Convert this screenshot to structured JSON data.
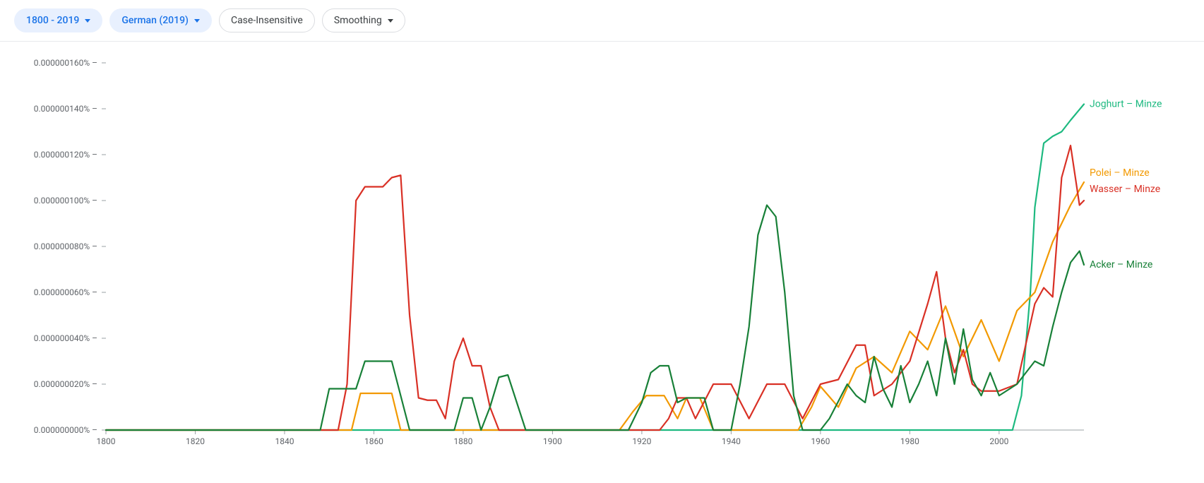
{
  "toolbar": {
    "range_label": "1800 - 2019",
    "corpus_label": "German (2019)",
    "case_label": "Case-Insensitive",
    "smoothing_label": "Smoothing"
  },
  "chart_data": {
    "type": "line",
    "x_start": 1800,
    "x_end": 2019,
    "x_ticks": [
      1800,
      1820,
      1840,
      1860,
      1880,
      1900,
      1920,
      1940,
      1960,
      1980,
      2000
    ],
    "ylim": [
      0,
      1.6e-07
    ],
    "y_ticks": [
      {
        "v": 0.0,
        "label": "0.000000000%"
      },
      {
        "v": 2e-08,
        "label": "0.000000020%"
      },
      {
        "v": 4e-08,
        "label": "0.000000040%"
      },
      {
        "v": 6e-08,
        "label": "0.000000060%"
      },
      {
        "v": 8e-08,
        "label": "0.000000080%"
      },
      {
        "v": 1e-07,
        "label": "0.000000100%"
      },
      {
        "v": 1.2e-07,
        "label": "0.000000120%"
      },
      {
        "v": 1.4e-07,
        "label": "0.000000140%"
      },
      {
        "v": 1.6e-07,
        "label": "0.000000160%"
      }
    ],
    "series": [
      {
        "name": "Joghurt – Minze",
        "color": "#1db980",
        "label_y": 1.42e-07,
        "points": [
          [
            1800,
            0
          ],
          [
            2000,
            0
          ],
          [
            2003,
            0
          ],
          [
            2005,
            1.5e-08
          ],
          [
            2007,
            6e-08
          ],
          [
            2008,
            9.7e-08
          ],
          [
            2010,
            1.25e-07
          ],
          [
            2012,
            1.28e-07
          ],
          [
            2014,
            1.3e-07
          ],
          [
            2016,
            1.35e-07
          ],
          [
            2019,
            1.42e-07
          ]
        ]
      },
      {
        "name": "Polei – Minze",
        "color": "#f29900",
        "label_y": 1.12e-07,
        "points": [
          [
            1800,
            0
          ],
          [
            1855,
            0
          ],
          [
            1857,
            1.6e-08
          ],
          [
            1862,
            1.6e-08
          ],
          [
            1864,
            1.6e-08
          ],
          [
            1866,
            0
          ],
          [
            1915,
            0
          ],
          [
            1918,
            8e-09
          ],
          [
            1921,
            1.5e-08
          ],
          [
            1925,
            1.5e-08
          ],
          [
            1928,
            5e-09
          ],
          [
            1930,
            1.4e-08
          ],
          [
            1933,
            1.4e-08
          ],
          [
            1936,
            0
          ],
          [
            1955,
            0
          ],
          [
            1958,
            1e-08
          ],
          [
            1960,
            1.9e-08
          ],
          [
            1964,
            1e-08
          ],
          [
            1968,
            2.7e-08
          ],
          [
            1972,
            3.2e-08
          ],
          [
            1976,
            2.5e-08
          ],
          [
            1980,
            4.3e-08
          ],
          [
            1984,
            3.5e-08
          ],
          [
            1988,
            5.4e-08
          ],
          [
            1992,
            3.2e-08
          ],
          [
            1996,
            4.8e-08
          ],
          [
            2000,
            3e-08
          ],
          [
            2004,
            5.2e-08
          ],
          [
            2008,
            6e-08
          ],
          [
            2012,
            8.2e-08
          ],
          [
            2016,
            9.8e-08
          ],
          [
            2019,
            1.08e-07
          ]
        ]
      },
      {
        "name": "Wasser – Minze",
        "color": "#d93025",
        "label_y": 1.05e-07,
        "points": [
          [
            1800,
            0
          ],
          [
            1852,
            0
          ],
          [
            1854,
            2e-08
          ],
          [
            1856,
            1e-07
          ],
          [
            1858,
            1.06e-07
          ],
          [
            1860,
            1.06e-07
          ],
          [
            1862,
            1.06e-07
          ],
          [
            1864,
            1.1e-07
          ],
          [
            1866,
            1.11e-07
          ],
          [
            1868,
            5e-08
          ],
          [
            1870,
            1.4e-08
          ],
          [
            1872,
            1.3e-08
          ],
          [
            1874,
            1.3e-08
          ],
          [
            1876,
            5e-09
          ],
          [
            1878,
            3e-08
          ],
          [
            1880,
            4e-08
          ],
          [
            1882,
            2.8e-08
          ],
          [
            1884,
            2.8e-08
          ],
          [
            1886,
            1e-08
          ],
          [
            1888,
            0
          ],
          [
            1924,
            0
          ],
          [
            1926,
            5e-09
          ],
          [
            1928,
            1.4e-08
          ],
          [
            1930,
            1.4e-08
          ],
          [
            1932,
            5e-09
          ],
          [
            1936,
            2e-08
          ],
          [
            1940,
            2e-08
          ],
          [
            1944,
            5e-09
          ],
          [
            1948,
            2e-08
          ],
          [
            1952,
            2e-08
          ],
          [
            1956,
            5e-09
          ],
          [
            1960,
            2e-08
          ],
          [
            1964,
            2.2e-08
          ],
          [
            1968,
            3.7e-08
          ],
          [
            1970,
            3.7e-08
          ],
          [
            1972,
            1.5e-08
          ],
          [
            1976,
            2e-08
          ],
          [
            1980,
            3e-08
          ],
          [
            1984,
            5.5e-08
          ],
          [
            1986,
            6.9e-08
          ],
          [
            1988,
            4e-08
          ],
          [
            1990,
            2.5e-08
          ],
          [
            1992,
            3.5e-08
          ],
          [
            1994,
            2e-08
          ],
          [
            1996,
            1.7e-08
          ],
          [
            1998,
            1.7e-08
          ],
          [
            2000,
            1.7e-08
          ],
          [
            2004,
            2e-08
          ],
          [
            2008,
            5.5e-08
          ],
          [
            2010,
            6.2e-08
          ],
          [
            2012,
            5.8e-08
          ],
          [
            2014,
            1.1e-07
          ],
          [
            2016,
            1.24e-07
          ],
          [
            2018,
            9.8e-08
          ],
          [
            2019,
            1e-07
          ]
        ]
      },
      {
        "name": "Acker – Minze",
        "color": "#188038",
        "label_y": 7.2e-08,
        "points": [
          [
            1800,
            0
          ],
          [
            1848,
            0
          ],
          [
            1850,
            1.8e-08
          ],
          [
            1852,
            1.8e-08
          ],
          [
            1854,
            1.8e-08
          ],
          [
            1856,
            1.8e-08
          ],
          [
            1858,
            3e-08
          ],
          [
            1860,
            3e-08
          ],
          [
            1862,
            3e-08
          ],
          [
            1864,
            3e-08
          ],
          [
            1866,
            1.5e-08
          ],
          [
            1868,
            0
          ],
          [
            1878,
            0
          ],
          [
            1880,
            1.4e-08
          ],
          [
            1882,
            1.4e-08
          ],
          [
            1884,
            0
          ],
          [
            1886,
            1e-08
          ],
          [
            1888,
            2.3e-08
          ],
          [
            1890,
            2.4e-08
          ],
          [
            1892,
            1.2e-08
          ],
          [
            1894,
            0
          ],
          [
            1917,
            0
          ],
          [
            1920,
            1.2e-08
          ],
          [
            1922,
            2.5e-08
          ],
          [
            1924,
            2.8e-08
          ],
          [
            1926,
            2.8e-08
          ],
          [
            1928,
            1.2e-08
          ],
          [
            1930,
            1.4e-08
          ],
          [
            1932,
            1.4e-08
          ],
          [
            1934,
            1.4e-08
          ],
          [
            1936,
            0
          ],
          [
            1940,
            0
          ],
          [
            1942,
            2e-08
          ],
          [
            1944,
            4.5e-08
          ],
          [
            1946,
            8.5e-08
          ],
          [
            1948,
            9.8e-08
          ],
          [
            1950,
            9.3e-08
          ],
          [
            1952,
            6e-08
          ],
          [
            1954,
            1.5e-08
          ],
          [
            1956,
            0
          ],
          [
            1960,
            0
          ],
          [
            1962,
            5e-09
          ],
          [
            1966,
            2e-08
          ],
          [
            1968,
            1.5e-08
          ],
          [
            1970,
            1.2e-08
          ],
          [
            1972,
            3.2e-08
          ],
          [
            1974,
            1.8e-08
          ],
          [
            1976,
            1e-08
          ],
          [
            1978,
            2.8e-08
          ],
          [
            1980,
            1.2e-08
          ],
          [
            1982,
            2e-08
          ],
          [
            1984,
            3e-08
          ],
          [
            1986,
            1.5e-08
          ],
          [
            1988,
            4e-08
          ],
          [
            1990,
            2e-08
          ],
          [
            1992,
            4.4e-08
          ],
          [
            1994,
            2.2e-08
          ],
          [
            1996,
            1.5e-08
          ],
          [
            1998,
            2.5e-08
          ],
          [
            2000,
            1.5e-08
          ],
          [
            2004,
            2e-08
          ],
          [
            2008,
            3e-08
          ],
          [
            2010,
            2.8e-08
          ],
          [
            2012,
            4.5e-08
          ],
          [
            2014,
            6e-08
          ],
          [
            2016,
            7.3e-08
          ],
          [
            2018,
            7.8e-08
          ],
          [
            2019,
            7.2e-08
          ]
        ]
      }
    ]
  }
}
